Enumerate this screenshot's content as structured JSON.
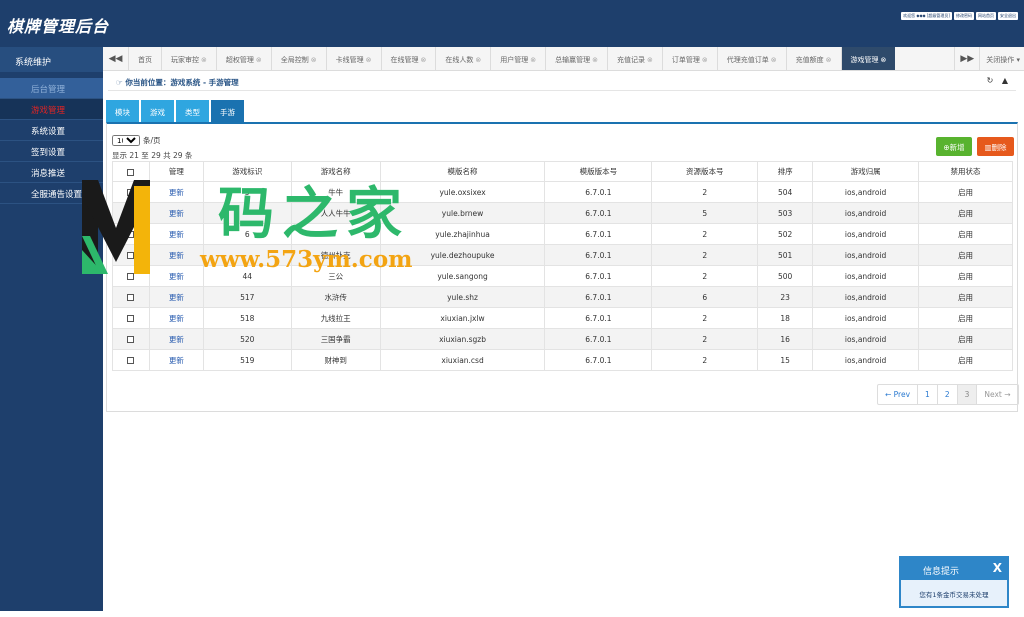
{
  "header": {
    "logo": "棋牌管理后台",
    "user_links": [
      "欢迎您 ◆◆◆ [超级管理员]",
      "修改密码",
      "网站首页",
      "安全退出"
    ]
  },
  "sidebar": {
    "title": "系统维护",
    "items": [
      {
        "label": "后台管理"
      },
      {
        "label": "游戏管理"
      },
      {
        "label": "系统设置"
      },
      {
        "label": "签到设置"
      },
      {
        "label": "消息推送"
      },
      {
        "label": "全服通告设置"
      }
    ]
  },
  "tabs": {
    "items": [
      {
        "label": "首页"
      },
      {
        "label": "玩家审控"
      },
      {
        "label": "超权管理"
      },
      {
        "label": "全局控制"
      },
      {
        "label": "卡线管理"
      },
      {
        "label": "在线管理"
      },
      {
        "label": "在线人数"
      },
      {
        "label": "用户管理"
      },
      {
        "label": "总输赢管理"
      },
      {
        "label": "充值记录"
      },
      {
        "label": "订单管理"
      },
      {
        "label": "代理充值订单"
      },
      {
        "label": "充值额度"
      },
      {
        "label": "游戏管理"
      }
    ],
    "close_ops": "关闭操作 ▾"
  },
  "breadcrumb": "你当前位置：游戏系统 - 手游管理",
  "subtabs": [
    "模块",
    "游戏",
    "类型",
    "手游"
  ],
  "list": {
    "perpage_value": "10",
    "perpage_unit": "条/页",
    "showing": "显示 21 至 29 共 29 条",
    "add_label": "新增",
    "delete_label": "删除"
  },
  "table": {
    "headers": [
      "",
      "管理",
      "游戏标识",
      "游戏名称",
      "模版名称",
      "模版版本号",
      "资源版本号",
      "排序",
      "游戏归属",
      "禁用状态"
    ],
    "rows": [
      {
        "action": "更新",
        "id": "5",
        "name": "牛牛",
        "template": "yule.oxsixex",
        "tpl_ver": "6.7.0.1",
        "res_ver": "2",
        "order": "504",
        "platform": "ios,android",
        "status": "启用"
      },
      {
        "action": "更新",
        "id": "",
        "name": "人人牛牛",
        "template": "yule.brnew",
        "tpl_ver": "6.7.0.1",
        "res_ver": "5",
        "order": "503",
        "platform": "ios,android",
        "status": "启用"
      },
      {
        "action": "更新",
        "id": "6",
        "name": "",
        "template": "yule.zhajinhua",
        "tpl_ver": "6.7.0.1",
        "res_ver": "2",
        "order": "502",
        "platform": "ios,android",
        "status": "启用"
      },
      {
        "action": "更新",
        "id": "",
        "name": "德州扑克",
        "template": "yule.dezhoupuke",
        "tpl_ver": "6.7.0.1",
        "res_ver": "2",
        "order": "501",
        "platform": "ios,android",
        "status": "启用"
      },
      {
        "action": "更新",
        "id": "44",
        "name": "三公",
        "template": "yule.sangong",
        "tpl_ver": "6.7.0.1",
        "res_ver": "2",
        "order": "500",
        "platform": "ios,android",
        "status": "启用"
      },
      {
        "action": "更新",
        "id": "517",
        "name": "水浒传",
        "template": "yule.shz",
        "tpl_ver": "6.7.0.1",
        "res_ver": "6",
        "order": "23",
        "platform": "ios,android",
        "status": "启用"
      },
      {
        "action": "更新",
        "id": "518",
        "name": "九线拉王",
        "template": "xiuxian.jxlw",
        "tpl_ver": "6.7.0.1",
        "res_ver": "2",
        "order": "18",
        "platform": "ios,android",
        "status": "启用"
      },
      {
        "action": "更新",
        "id": "520",
        "name": "三国争霸",
        "template": "xiuxian.sgzb",
        "tpl_ver": "6.7.0.1",
        "res_ver": "2",
        "order": "16",
        "platform": "ios,android",
        "status": "启用"
      },
      {
        "action": "更新",
        "id": "519",
        "name": "财神到",
        "template": "xiuxian.csd",
        "tpl_ver": "6.7.0.1",
        "res_ver": "2",
        "order": "15",
        "platform": "ios,android",
        "status": "启用"
      }
    ]
  },
  "pagination": [
    "← Prev",
    "1",
    "2",
    "3",
    "Next →"
  ],
  "watermark": {
    "text": "码之家",
    "url": "www.573ym.com"
  },
  "notify": {
    "title": "信息提示",
    "close": "X",
    "message": "您有1条金币交易未处理"
  },
  "colors": {
    "header": "#1e3f6c",
    "subtab": "#2fa6e0",
    "subtab_active": "#1a72b0",
    "add": "#58b32f",
    "delete": "#e6591c",
    "active_menu": "#e02424"
  }
}
